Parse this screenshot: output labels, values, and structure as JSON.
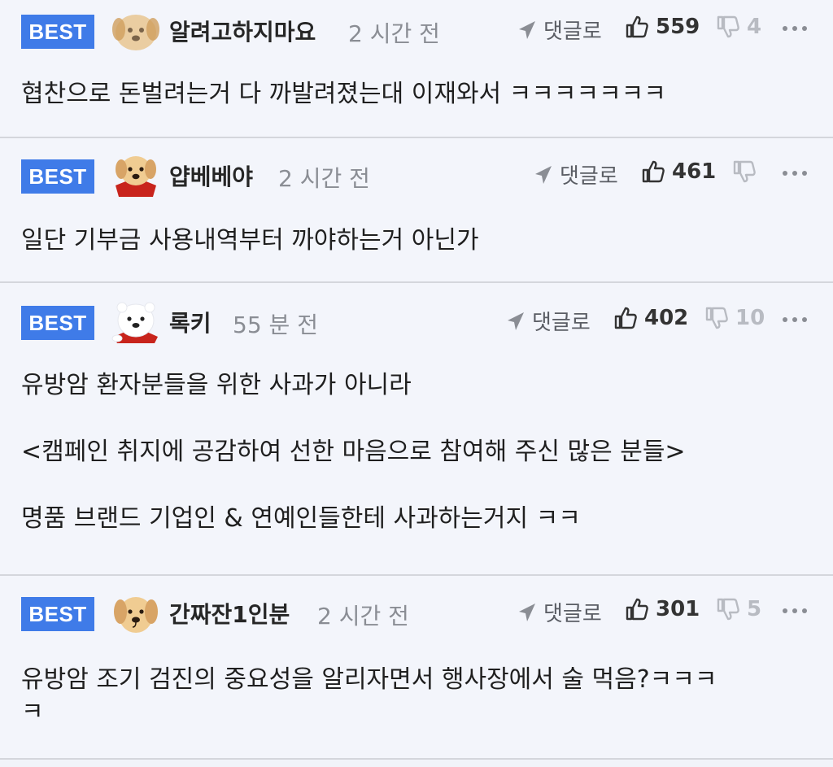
{
  "comments": [
    {
      "badge": "BEST",
      "avatar": "puppy-blurred-icon",
      "author": "알려고하지마요",
      "time": "2 시간 전",
      "reply_label": "댓글로",
      "likes": "559",
      "dislikes": "4",
      "paragraphs": [
        "협찬으로 돈벌려는거 다 까발려졌는대 이재와서 ㅋㅋㅋㅋㅋㅋㅋ"
      ]
    },
    {
      "badge": "BEST",
      "avatar": "puppy-red-cape-icon",
      "author": "얍베베야",
      "time": "2 시간 전",
      "reply_label": "댓글로",
      "likes": "461",
      "dislikes": "",
      "paragraphs": [
        "일단 기부금 사용내역부터 까야하는거 아닌가"
      ]
    },
    {
      "badge": "BEST",
      "avatar": "polar-bear-icon",
      "author": "록키",
      "time": "55 분 전",
      "reply_label": "댓글로",
      "likes": "402",
      "dislikes": "10",
      "paragraphs": [
        "유방암 환자분들을 위한 사과가 아니라",
        "<캠페인 취지에 공감하여 선한 마음으로 참여해 주신 많은 분들>",
        "명품 브랜드 기업인 & 연예인들한테 사과하는거지 ㅋㅋ"
      ]
    },
    {
      "badge": "BEST",
      "avatar": "puppy-icon",
      "author": "간짜잔1인분",
      "time": "2 시간 전",
      "reply_label": "댓글로",
      "likes": "301",
      "dislikes": "5",
      "paragraphs": [
        "유방암 조기 검진의 중요성을 알리자면서 행사장에서 술 먹음?ㅋㅋㅋ",
        "ㅋ"
      ]
    }
  ],
  "colors": {
    "badge": "#3f7be8",
    "background": "#f3f5fb",
    "divider": "#d4d6dc",
    "time": "#8a8d94"
  }
}
